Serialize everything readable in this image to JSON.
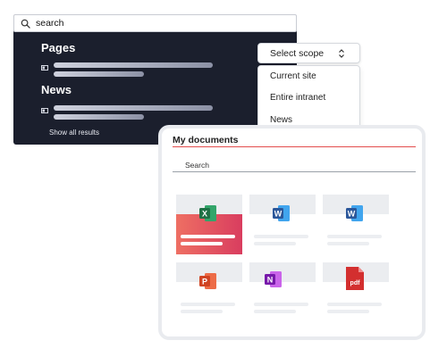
{
  "search": {
    "value": "search"
  },
  "results": {
    "sections": [
      {
        "title": "Pages"
      },
      {
        "title": "News"
      }
    ],
    "show_all_label": "Show all results"
  },
  "scope": {
    "button_label": "Select scope",
    "options": [
      "Current site",
      "Entire intranet",
      "News"
    ]
  },
  "documents": {
    "title": "My documents",
    "search_label": "Search",
    "files": [
      {
        "icon": "excel-icon",
        "letter": "X",
        "color": "#1e7145",
        "highlighted": true
      },
      {
        "icon": "word-icon",
        "letter": "W",
        "color": "#2b579a",
        "highlighted": false
      },
      {
        "icon": "word-icon",
        "letter": "W",
        "color": "#2b579a",
        "highlighted": false
      },
      {
        "icon": "powerpoint-icon",
        "letter": "P",
        "color": "#d04423",
        "highlighted": false
      },
      {
        "icon": "onenote-icon",
        "letter": "N",
        "color": "#7719aa",
        "highlighted": false
      },
      {
        "icon": "pdf-icon",
        "letter": "pdf",
        "color": "#d32f2f",
        "highlighted": false
      }
    ]
  },
  "colors": {
    "dark_panel": "#1b1f2d",
    "accent_red": "#e34c4c",
    "highlight_gradient": [
      "#ee6f63",
      "#d93d5f"
    ]
  }
}
